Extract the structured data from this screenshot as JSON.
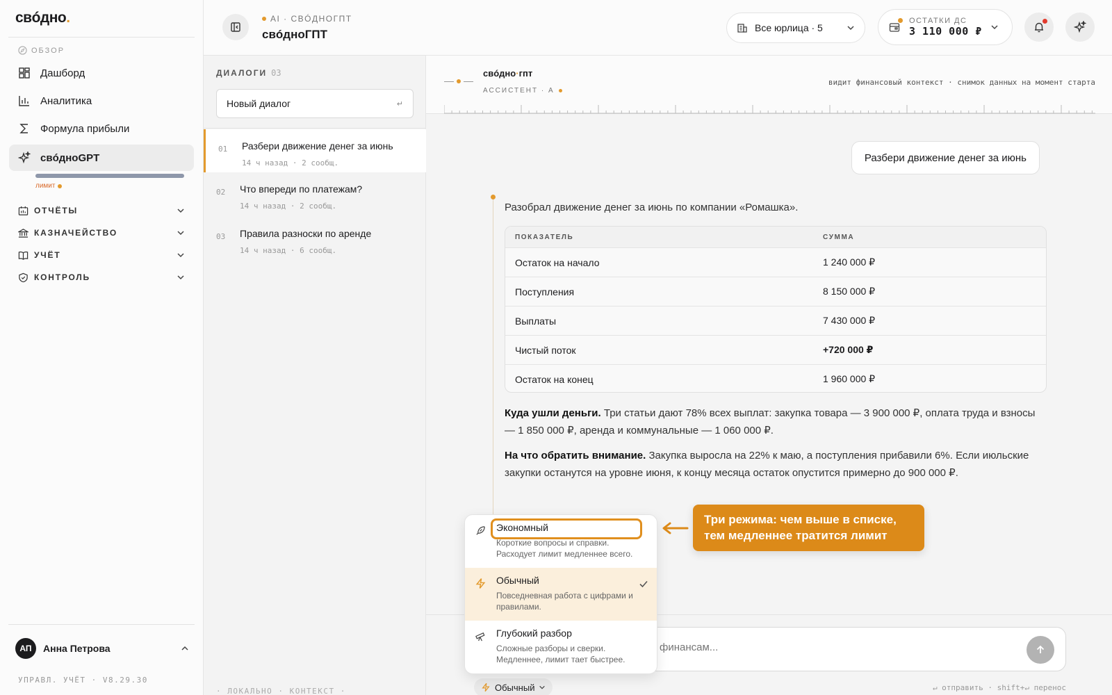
{
  "app": {
    "logo": "свóдно",
    "logo_dot": "."
  },
  "sidebar": {
    "section_overview": "ОБЗОР",
    "items": [
      {
        "label": "Дашборд",
        "icon": "grid-icon"
      },
      {
        "label": "Аналитика",
        "icon": "bar-chart-icon"
      },
      {
        "label": "Формула прибыли",
        "icon": "sigma-icon"
      },
      {
        "label": "свóдноGPT",
        "icon": "sparkles-icon",
        "active": true
      }
    ],
    "limit_label": "лимит",
    "limit_fraction": 1.0,
    "groups": [
      {
        "label": "ОТЧЁТЫ",
        "icon": "calendar-chart-icon"
      },
      {
        "label": "КАЗНАЧЕЙСТВО",
        "icon": "bank-icon"
      },
      {
        "label": "УЧЁТ",
        "icon": "book-icon"
      },
      {
        "label": "КОНТРОЛЬ",
        "icon": "shield-icon"
      }
    ],
    "user": {
      "initials": "АП",
      "name": "Анна Петрова"
    },
    "version": "УПРАВЛ. УЧЁТ · V8.29.30"
  },
  "topbar": {
    "crumb": "AI · СВÓДНОГПТ",
    "title": "свóдноГПТ",
    "entities": "Все юрлица · 5",
    "balance_label": "ОСТАТКИ ДС",
    "balance_value": "3 110 000 ₽"
  },
  "dialogs": {
    "heading": "ДИАЛОГИ",
    "count": "03",
    "new_dialog": "Новый диалог",
    "new_dialog_hint": "↵",
    "list": [
      {
        "num": "01",
        "title": "Разбери движение денег за июнь",
        "meta": "14 ч назад · 2 сообщ.",
        "active": true
      },
      {
        "num": "02",
        "title": "Что впереди по платежам?",
        "meta": "14 ч назад · 2 сообщ."
      },
      {
        "num": "03",
        "title": "Правила разноски по аренде",
        "meta": "14 ч назад · 6 сообщ."
      }
    ],
    "footer": "· ЛОКАЛЬНО · КОНТЕКСТ ·"
  },
  "chat": {
    "assistant_name": "свóдно",
    "assistant_name_dot": "·",
    "assistant_name_tail": "гпт",
    "assistant_role": "АССИСТЕНТ · А",
    "context": "видит финансовый контекст  ·  снимок данных на момент старта",
    "user_message": "Разбери движение денег за июнь",
    "answer_intro": "Разобрал движение денег за июнь по компании «Ромашка».",
    "table": {
      "headers": [
        "ПОКАЗАТЕЛЬ",
        "СУММА"
      ],
      "rows": [
        {
          "label": "Остаток на начало",
          "value": "1 240 000 ₽"
        },
        {
          "label": "Поступления",
          "value": "8 150 000 ₽"
        },
        {
          "label": "Выплаты",
          "value": "7 430 000 ₽"
        },
        {
          "label": "Чистый поток",
          "value": "+720 000 ₽",
          "bold": true
        },
        {
          "label": "Остаток на конец",
          "value": "1 960 000 ₽"
        }
      ]
    },
    "p1_bold": "Куда ушли деньги.",
    "p1_text": " Три статьи дают 78% всех выплат: закупка товара — 3 900 000 ₽, оплата труда и взносы — 1 850 000 ₽, аренда и коммунальные — 1 060 000 ₽.",
    "p2_bold": "На что обратить внимание.",
    "p2_text": " Закупка выросла на 22% к маю, а поступления прибавили 6%. Если июльские закупки останутся на уровне июня, к концу месяца остаток опустится примерно до 900 000 ₽."
  },
  "modes": [
    {
      "name": "Экономный",
      "desc": "Короткие вопросы и справки. Расходует лимит медленнее всего.",
      "icon": "feather-icon",
      "focused": true
    },
    {
      "name": "Обычный",
      "desc": "Повседневная работа с цифрами и правилами.",
      "icon": "lightning-icon",
      "selected": true
    },
    {
      "name": "Глубокий разбор",
      "desc": "Сложные разборы и сверки. Медленнее, лимит тает быстрее.",
      "icon": "telescope-icon"
    }
  ],
  "callout": "Три режима: чем выше в списке, тем медленнее тратится лимит",
  "composer": {
    "placeholder": "финансам...",
    "mode_label": "Обычный",
    "hint": "↵ отправить · shift+↵ перенос"
  },
  "colors": {
    "accent": "#e39a2d",
    "callout": "#dc8a19",
    "dark": "#1c1c1e"
  }
}
